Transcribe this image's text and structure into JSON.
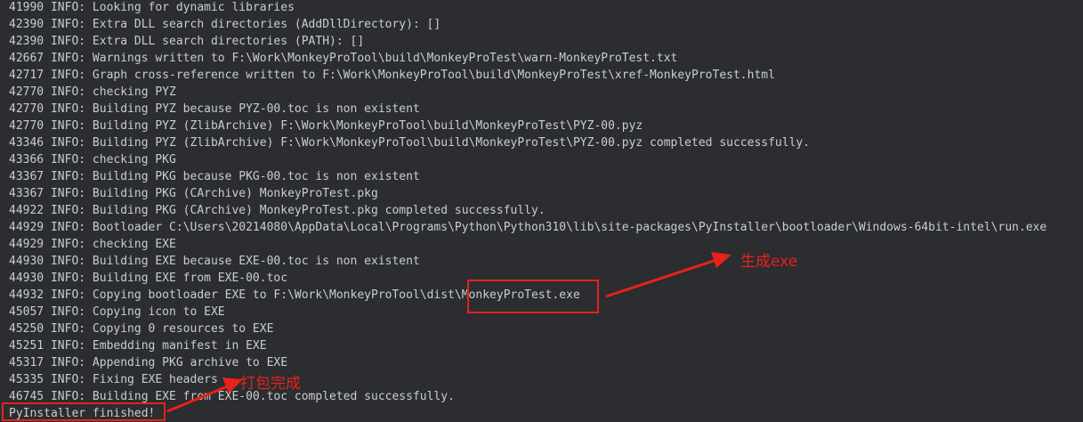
{
  "terminal": {
    "lines": [
      "41990 INFO: Looking for dynamic libraries",
      "42390 INFO: Extra DLL search directories (AddDllDirectory): []",
      "42390 INFO: Extra DLL search directories (PATH): []",
      "42667 INFO: Warnings written to F:\\Work\\MonkeyProTool\\build\\MonkeyProTest\\warn-MonkeyProTest.txt",
      "42717 INFO: Graph cross-reference written to F:\\Work\\MonkeyProTool\\build\\MonkeyProTest\\xref-MonkeyProTest.html",
      "42770 INFO: checking PYZ",
      "42770 INFO: Building PYZ because PYZ-00.toc is non existent",
      "42770 INFO: Building PYZ (ZlibArchive) F:\\Work\\MonkeyProTool\\build\\MonkeyProTest\\PYZ-00.pyz",
      "43346 INFO: Building PYZ (ZlibArchive) F:\\Work\\MonkeyProTool\\build\\MonkeyProTest\\PYZ-00.pyz completed successfully.",
      "43366 INFO: checking PKG",
      "43367 INFO: Building PKG because PKG-00.toc is non existent",
      "43367 INFO: Building PKG (CArchive) MonkeyProTest.pkg",
      "44922 INFO: Building PKG (CArchive) MonkeyProTest.pkg completed successfully.",
      "44929 INFO: Bootloader C:\\Users\\20214080\\AppData\\Local\\Programs\\Python\\Python310\\lib\\site-packages\\PyInstaller\\bootloader\\Windows-64bit-intel\\run.exe",
      "44929 INFO: checking EXE",
      "44930 INFO: Building EXE because EXE-00.toc is non existent",
      "44930 INFO: Building EXE from EXE-00.toc",
      "44932 INFO: Copying bootloader EXE to F:\\Work\\MonkeyProTool\\dist\\MonkeyProTest.exe",
      "45057 INFO: Copying icon to EXE",
      "45250 INFO: Copying 0 resources to EXE",
      "45251 INFO: Embedding manifest in EXE",
      "45317 INFO: Appending PKG archive to EXE",
      "45335 INFO: Fixing EXE headers",
      "46745 INFO: Building EXE from EXE-00.toc completed successfully.",
      "PyInstaller finished!"
    ]
  },
  "annotations": {
    "generate_exe_label": "生成exe",
    "package_done_label": "打包完成",
    "color": "#e8211b"
  },
  "colors": {
    "background": "#2b2d30",
    "text": "#c9cdd2"
  }
}
